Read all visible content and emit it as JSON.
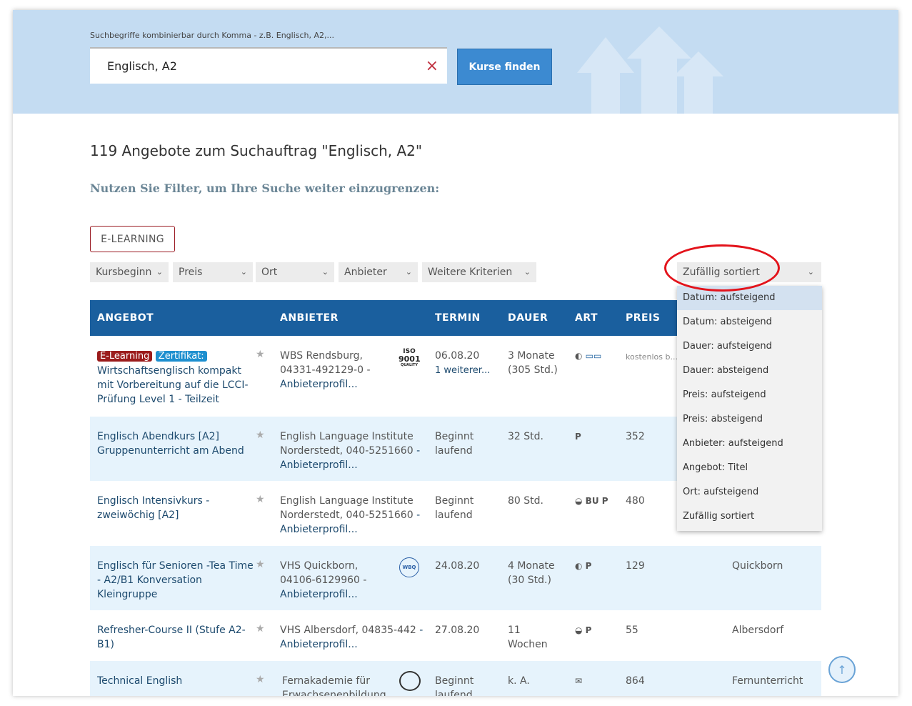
{
  "search": {
    "hint": "Suchbegriffe kombinierbar durch Komma - z.B. Englisch, A2,...",
    "value": "Englisch, A2",
    "clear_icon": "×",
    "button_label": "Kurse finden"
  },
  "results": {
    "title": "119 Angebote zum Suchauftrag \"Englisch, A2\"",
    "filter_hint": "Nutzen Sie Filter, um Ihre Suche weiter einzugrenzen:"
  },
  "filters": {
    "elearning": "E-LEARNING",
    "selects": [
      "Kursbeginn",
      "Preis",
      "Ort",
      "Anbieter",
      "Weitere Kriterien"
    ],
    "sort_value": "Zufällig sortiert"
  },
  "table": {
    "headers": [
      "ANGEBOT",
      "ANBIETER",
      "TERMIN",
      "DAUER",
      "ART",
      "PREIS"
    ],
    "rows": [
      {
        "tag1": "E-Learning",
        "tag2": "Zertifikat:",
        "title": "Wirtschaftsenglisch kompakt mit Vorbereitung auf die LCCI-Prüfung Level 1 - Teilzeit",
        "provider": "WBS Rendsburg, 04331-492129-0 -",
        "provider_link": "Anbieterprofil...",
        "termin": "06.08.20",
        "termin2": "1 weiterer...",
        "dauer": "3 Monate (305 Std.)",
        "art": "",
        "preis": "kostenlos b...",
        "ort": ""
      },
      {
        "title": "Englisch Abendkurs [A2] Gruppenunterricht am Abend",
        "provider": "English Language Institute Norderstedt, 040-5251660",
        "provider_link": "- Anbieterprofil...",
        "termin": "Beginnt laufend",
        "dauer": "32 Std.",
        "art": "P",
        "preis": "352",
        "ort": ""
      },
      {
        "title": "Englisch Intensivkurs - zweiwöchig [A2]",
        "provider": "English Language Institute Norderstedt, 040-5251660",
        "provider_link": "- Anbieterprofil...",
        "termin": "Beginnt laufend",
        "dauer": "80 Std.",
        "art": "BU P",
        "preis": "480",
        "ort": ""
      },
      {
        "title": "Englisch für Senioren -Tea Time - A2/B1 Konversation Kleingruppe",
        "provider": "VHS Quickborn, 04106-6129960 -",
        "provider_link": "Anbieterprofil...",
        "termin": "24.08.20",
        "dauer": "4 Monate (30 Std.)",
        "art": "P",
        "preis": "129",
        "ort": "Quickborn"
      },
      {
        "title": "Refresher-Course II (Stufe A2-B1)",
        "provider": "VHS Albersdorf, 04835-442",
        "provider_link": "- Anbieterprofil...",
        "termin": "27.08.20",
        "dauer": "11 Wochen",
        "art": "P",
        "preis": "55",
        "ort": "Albersdorf"
      },
      {
        "title": "Technical English",
        "provider": "Fernakademie für Erwachsenenbildung",
        "termin": "Beginnt laufend",
        "dauer": "k. A.",
        "art": "",
        "preis": "864",
        "ort": "Fernunterricht"
      }
    ]
  },
  "sort_options": [
    "Datum: aufsteigend",
    "Datum: absteigend",
    "Dauer: aufsteigend",
    "Dauer: absteigend",
    "Preis: aufsteigend",
    "Preis: absteigend",
    "Anbieter: aufsteigend",
    "Angebot: Titel",
    "Ort: aufsteigend",
    "Zufällig sortiert"
  ],
  "logos": {
    "iso_line1": "ISO",
    "iso_line2": "9001",
    "iso_line3": "QUALITY",
    "vhs": "WBQ"
  },
  "scroll_top_icon": "↑",
  "colors": {
    "header_bg": "#1a5f9e",
    "hero_bg": "#c4dcf2",
    "accent_red": "#e3131b",
    "button_blue": "#3c8ad1"
  }
}
